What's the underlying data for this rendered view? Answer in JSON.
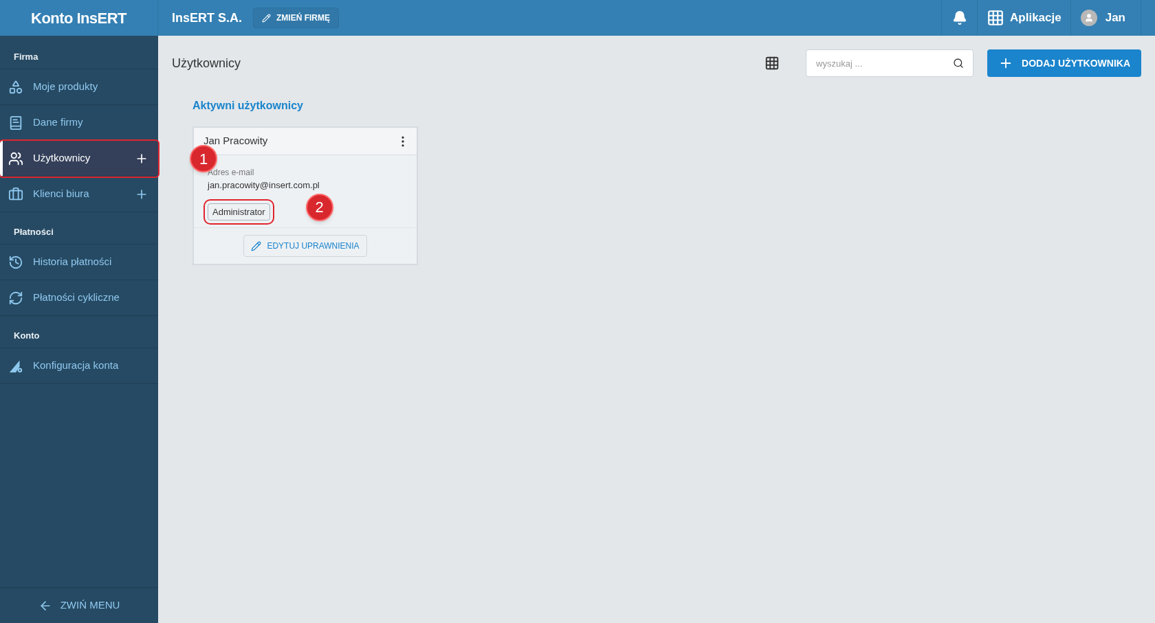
{
  "header": {
    "logo": "Konto InsERT",
    "company": "InsERT S.A.",
    "change_company_button": "ZMIEŃ FIRMĘ",
    "apps_label": "Aplikacje",
    "user_name": "Jan"
  },
  "sidebar": {
    "sections": [
      {
        "title": "Firma",
        "items": [
          {
            "label": "Moje produkty",
            "kind": "products",
            "add": false,
            "selected": false
          },
          {
            "label": "Dane firmy",
            "kind": "company",
            "add": false,
            "selected": false
          },
          {
            "label": "Użytkownicy",
            "kind": "users",
            "add": true,
            "selected": true,
            "callout": "1"
          },
          {
            "label": "Klienci biura",
            "kind": "clients",
            "add": true,
            "selected": false
          }
        ]
      },
      {
        "title": "Płatności",
        "items": [
          {
            "label": "Historia płatności",
            "kind": "history",
            "add": false,
            "selected": false
          },
          {
            "label": "Płatności cykliczne",
            "kind": "recurring",
            "add": false,
            "selected": false
          }
        ]
      },
      {
        "title": "Konto",
        "items": [
          {
            "label": "Konfiguracja konta",
            "kind": "config",
            "add": false,
            "selected": false
          }
        ]
      }
    ],
    "collapse_label": "ZWIŃ MENU"
  },
  "content": {
    "title": "Użytkownicy",
    "search": {
      "placeholder": "wyszukaj ..."
    },
    "add_button": "DODAJ UŻYTKOWNIKA",
    "section_title": "Aktywni użytkownicy",
    "users": [
      {
        "name": "Jan Pracowity",
        "email_label": "Adres e-mail",
        "email": "jan.pracowity@insert.com.pl",
        "role": "Administrator",
        "role_callout": "2",
        "edit_button": "EDYTUJ UPRAWNIENIA"
      }
    ]
  }
}
